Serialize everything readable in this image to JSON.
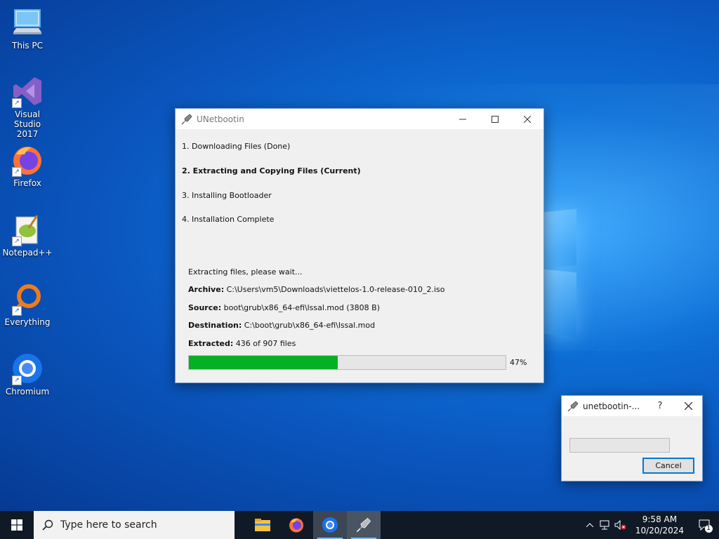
{
  "desktop": {
    "icons": [
      {
        "label": "This PC",
        "icon": "computer-icon"
      },
      {
        "label": "Visual Studio\n2017",
        "icon": "visual-studio-icon"
      },
      {
        "label": "Firefox",
        "icon": "firefox-icon"
      },
      {
        "label": "Notepad++",
        "icon": "notepadpp-icon"
      },
      {
        "label": "Everything",
        "icon": "everything-icon"
      },
      {
        "label": "Chromium",
        "icon": "chromium-icon"
      }
    ],
    "wallpaper_color": "#0d6fd6"
  },
  "main_window": {
    "title": "UNetbootin",
    "steps": [
      "1. Downloading Files (Done)",
      "2. Extracting and Copying Files (Current)",
      "3. Installing Bootloader",
      "4. Installation Complete"
    ],
    "status": "Extracting files, please wait...",
    "archive_label": "Archive:",
    "archive_value": " C:\\Users\\vm5\\Downloads\\viettelos-1.0-release-010_2.iso",
    "source_label": "Source:",
    "source_value": " boot\\grub\\x86_64-efi\\lssal.mod (3808 B)",
    "destination_label": "Destination:",
    "destination_value": " C:\\boot\\grub\\x86_64-efi\\lssal.mod",
    "extracted_label": "Extracted:",
    "extracted_value": " 436 of 907 files",
    "progress_percent": 47,
    "progress_text": "47%",
    "progress_color": "#06b025"
  },
  "small_dialog": {
    "title": "unetbootin-...",
    "help": "?",
    "cancel_label": "Cancel"
  },
  "taskbar": {
    "search_placeholder": "Type here to search",
    "time": "9:58 AM",
    "date": "10/20/2024",
    "notification_count": "1",
    "apps": [
      "file-explorer-icon",
      "firefox-icon",
      "chromium-icon",
      "unetbootin-icon"
    ]
  }
}
